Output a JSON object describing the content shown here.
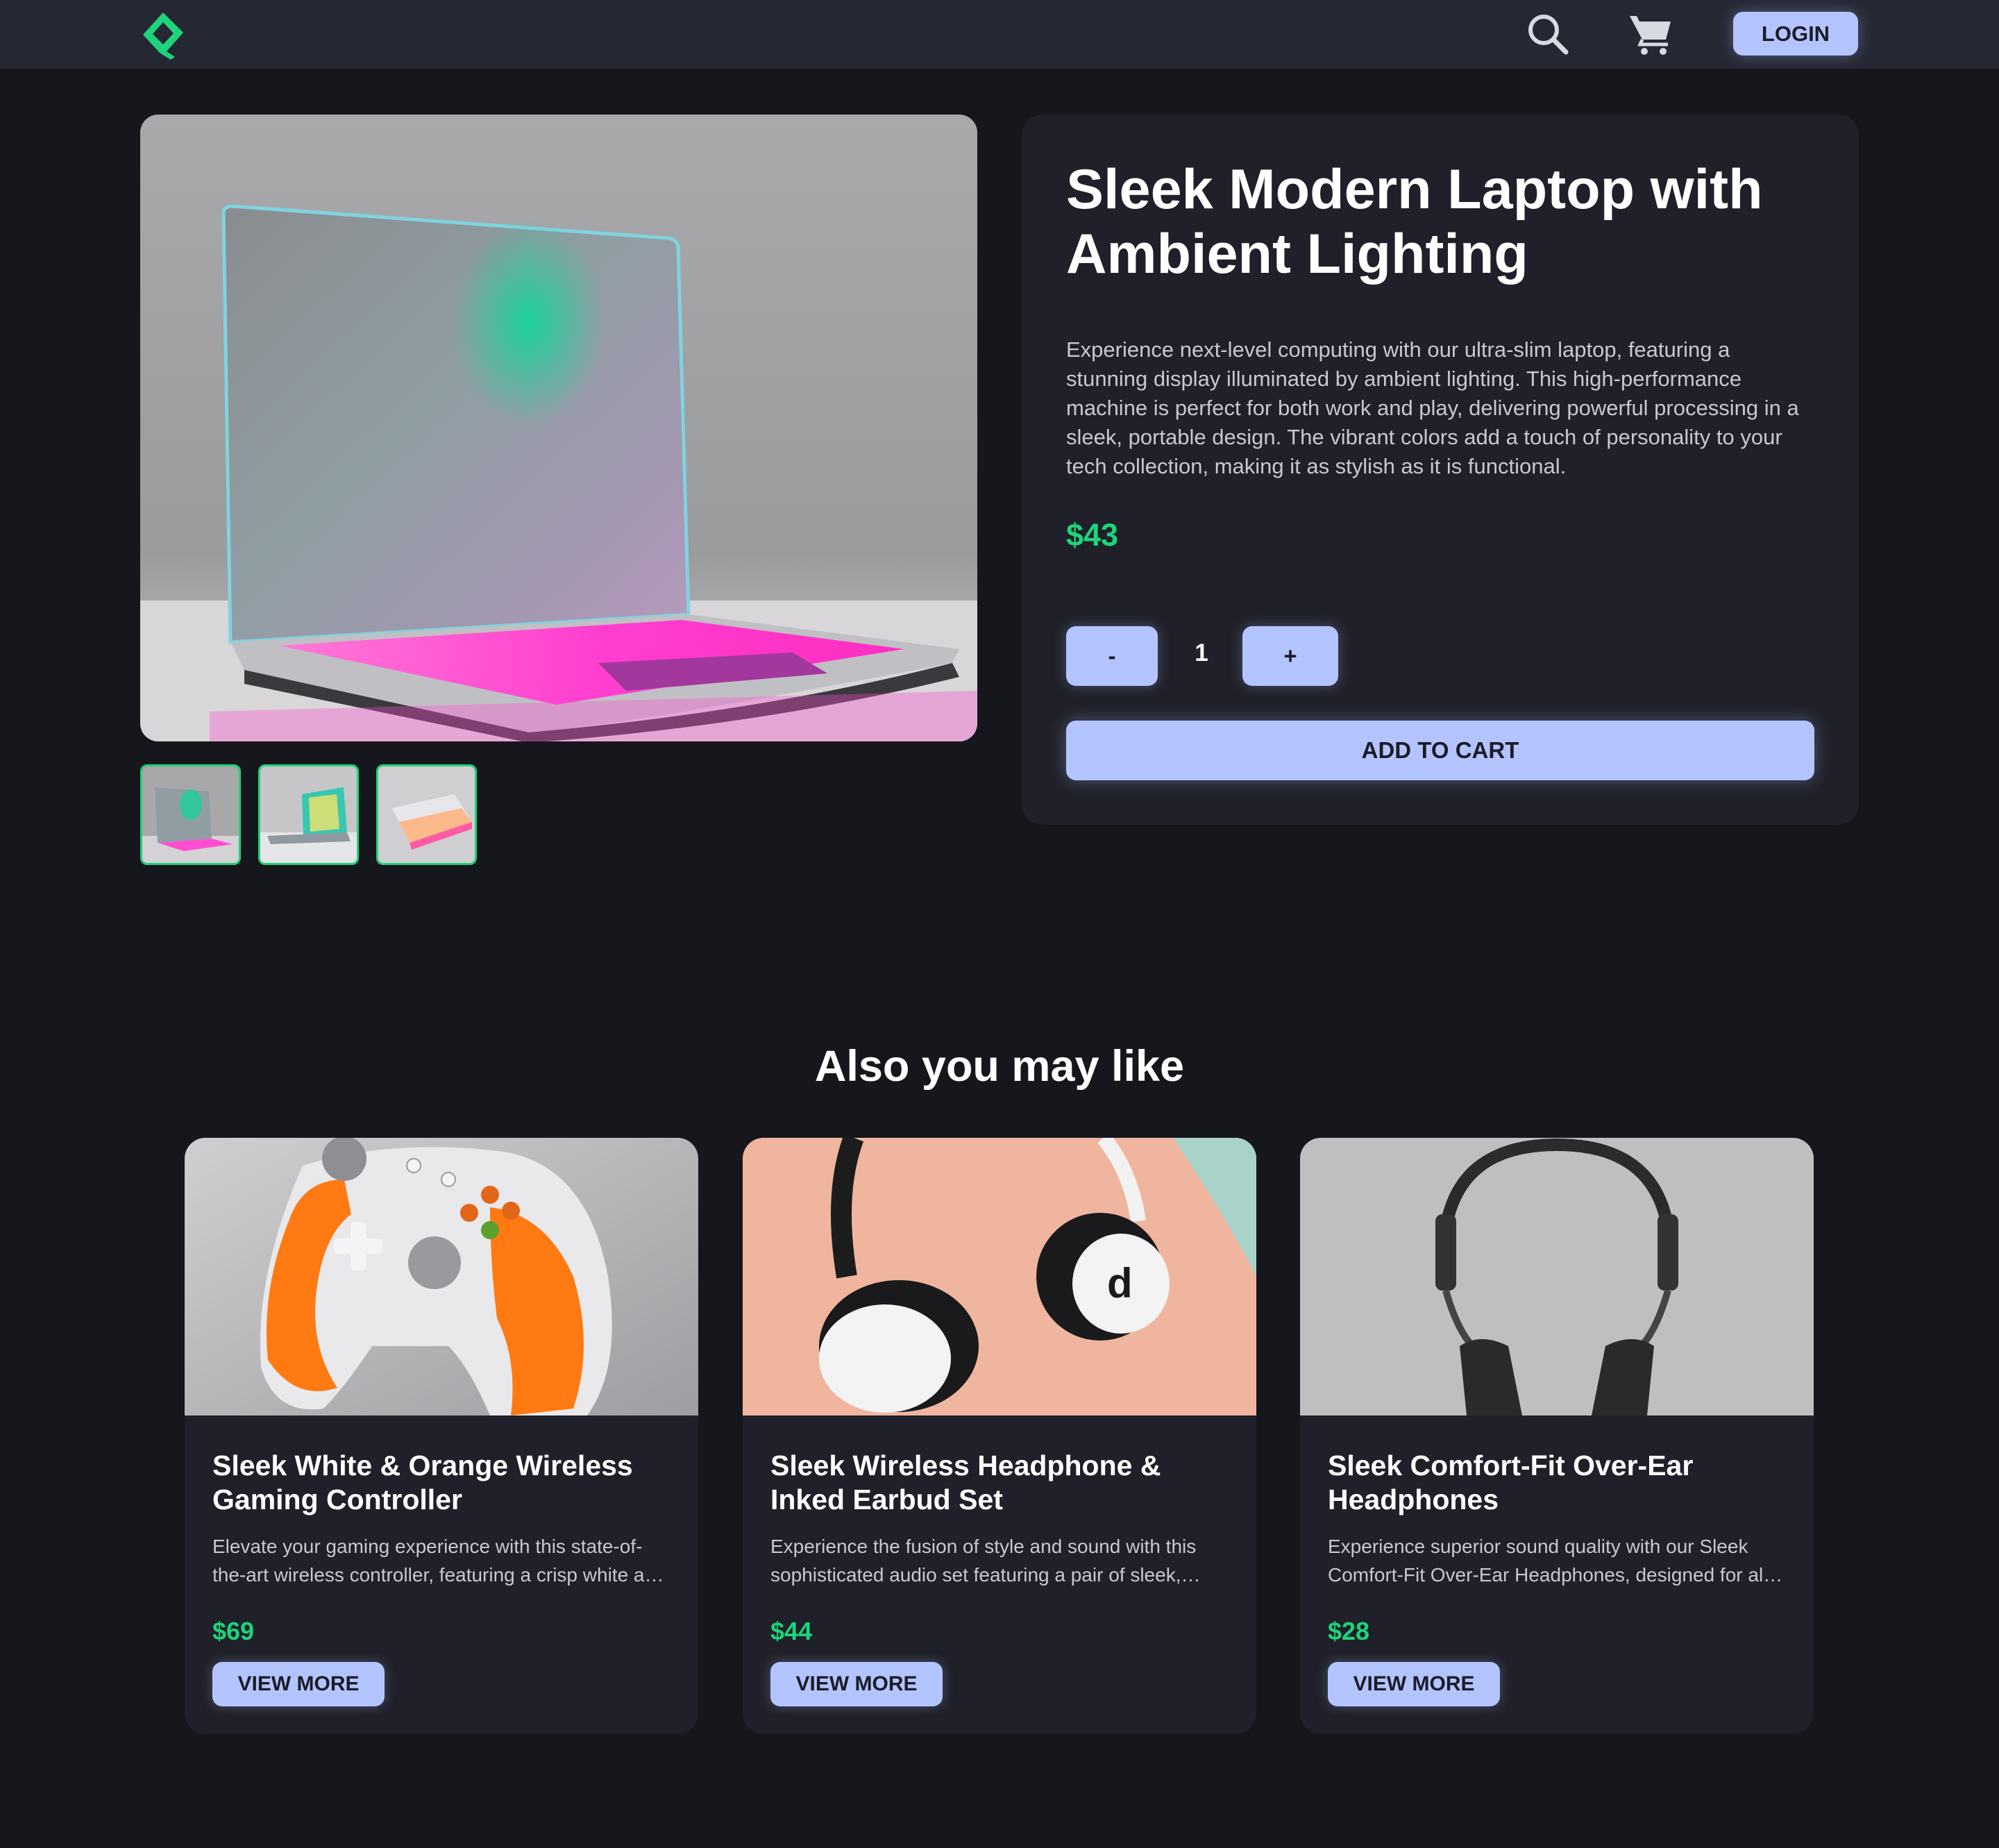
{
  "header": {
    "logo_icon": "diamond-logo-icon",
    "search_icon": "search-icon",
    "cart_icon": "cart-icon",
    "login_label": "LOGIN"
  },
  "colors": {
    "background": "#16171c",
    "header": "#252733",
    "card": "#1f2029",
    "accent_button": "#b3c4ff",
    "price_green": "#1ed47a"
  },
  "product": {
    "title": "Sleek Modern Laptop with Ambient Lighting",
    "description": "Experience next-level computing with our ultra-slim laptop, featuring a stunning display illuminated by ambient lighting. This high-performance machine is perfect for both work and play, delivering powerful processing in a sleek, portable design. The vibrant colors add a touch of personality to your tech collection, making it as stylish as it is functional.",
    "price": "$43",
    "quantity": "1",
    "minus_label": "-",
    "plus_label": "+",
    "add_to_cart_label": "ADD TO CART",
    "thumbnail_count": 3
  },
  "related": {
    "title": "Also you may like",
    "items": [
      {
        "title": "Sleek White & Orange Wireless Gaming Controller",
        "description": "Elevate your gaming experience with this state-of-the-art wireless controller, featuring a crisp white and orange design.",
        "price": "$69",
        "button_label": "VIEW MORE"
      },
      {
        "title": "Sleek Wireless Headphone & Inked Earbud Set",
        "description": "Experience the fusion of style and sound with this sophisticated audio set featuring a pair of sleek, wireless headphones.",
        "price": "$44",
        "button_label": "VIEW MORE"
      },
      {
        "title": "Sleek Comfort-Fit Over-Ear Headphones",
        "description": "Experience superior sound quality with our Sleek Comfort-Fit Over-Ear Headphones, designed for all-day comfort.",
        "price": "$28",
        "button_label": "VIEW MORE"
      }
    ]
  }
}
